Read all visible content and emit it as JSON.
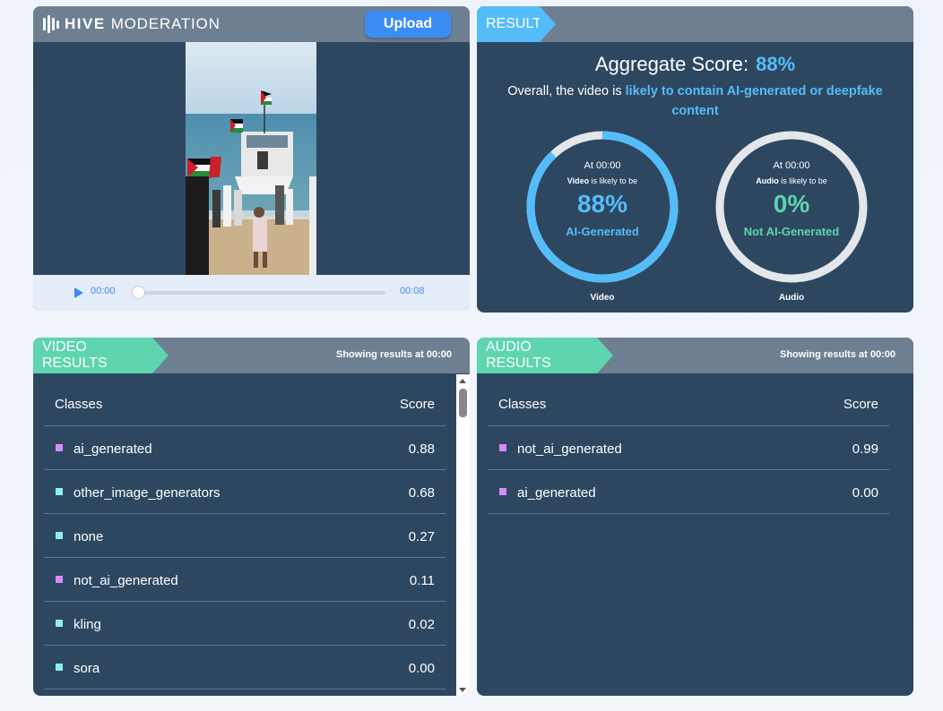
{
  "brand": {
    "name": "HIVE",
    "sub": "MODERATION"
  },
  "toolbar": {
    "upload_label": "Upload"
  },
  "player": {
    "current_time": "00:00",
    "duration": "00:08",
    "progress": 0
  },
  "result": {
    "tag": "RESULT",
    "aggregate_label": "Aggregate Score:",
    "aggregate_value": "88%",
    "overall_prefix": "Overall, the video is",
    "overall_highlight": "likely to contain AI-generated or deepfake content",
    "video_gauge": {
      "at": "At 00:00",
      "subject": "Video",
      "likely": "is likely to be",
      "percent": "88%",
      "value": 0.88,
      "label": "AI-Generated",
      "caption": "Video",
      "color": "#54bdf9"
    },
    "audio_gauge": {
      "at": "At 00:00",
      "subject": "Audio",
      "likely": "is likely to be",
      "percent": "0%",
      "value": 0.0,
      "label": "Not AI-Generated",
      "caption": "Audio",
      "color": "#5ed4af"
    }
  },
  "video_results": {
    "tag": "VIDEO RESULTS",
    "showing_prefix": "Showing results at",
    "showing_time": "00:00",
    "header": {
      "classes": "Classes",
      "score": "Score"
    },
    "rows": [
      {
        "cls": "ai_generated",
        "score": "0.88",
        "color": "#d98af7"
      },
      {
        "cls": "other_image_generators",
        "score": "0.68",
        "color": "#8ef1ec"
      },
      {
        "cls": "none",
        "score": "0.27",
        "color": "#8ef1ec"
      },
      {
        "cls": "not_ai_generated",
        "score": "0.11",
        "color": "#d98af7"
      },
      {
        "cls": "kling",
        "score": "0.02",
        "color": "#8ef1ec"
      },
      {
        "cls": "sora",
        "score": "0.00",
        "color": "#8ef1ec"
      }
    ]
  },
  "audio_results": {
    "tag": "AUDIO RESULTS",
    "showing_prefix": "Showing results at",
    "showing_time": "00:00",
    "header": {
      "classes": "Classes",
      "score": "Score"
    },
    "rows": [
      {
        "cls": "not_ai_generated",
        "score": "0.99",
        "color": "#d98af7"
      },
      {
        "cls": "ai_generated",
        "score": "0.00",
        "color": "#d98af7"
      }
    ]
  }
}
